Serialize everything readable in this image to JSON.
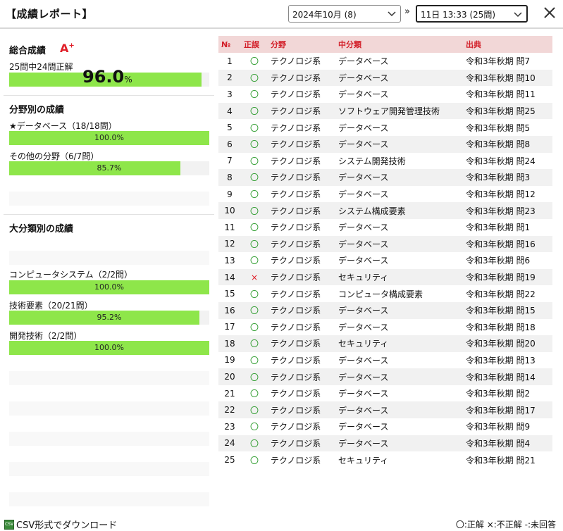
{
  "header": {
    "title": "【成績レポート】",
    "month_select": "2024年10月 (8)",
    "separator": "»",
    "session_select": "11日 13:33 (25問)"
  },
  "overall": {
    "title": "総合成績",
    "grade": "A",
    "grade_sup": "+",
    "summary": "25問中24問正解",
    "percent": "96.0",
    "percent_unit": "%",
    "bar_value": 96.0
  },
  "field": {
    "title": "分野別の成績",
    "items": [
      {
        "label": "★データベース（18/18問）",
        "bar_label": "100.0%",
        "value": 100.0
      },
      {
        "label": "その他の分野（6/7問）",
        "bar_label": "85.7%",
        "value": 85.7
      }
    ]
  },
  "category": {
    "title": "大分類別の成績",
    "items": [
      {
        "label": "コンピュータシステム（2/2問）",
        "bar_label": "100.0%",
        "value": 100.0
      },
      {
        "label": "技術要素（20/21問）",
        "bar_label": "95.2%",
        "value": 95.2
      },
      {
        "label": "開発技術（2/2問）",
        "bar_label": "100.0%",
        "value": 100.0
      }
    ]
  },
  "table": {
    "headers": [
      "№",
      "正誤",
      "分野",
      "中分類",
      "出典"
    ],
    "rows": [
      {
        "no": "1",
        "result": "〇",
        "field": "テクノロジ系",
        "category": "データベース",
        "source": "令和3年秋期 問7"
      },
      {
        "no": "2",
        "result": "〇",
        "field": "テクノロジ系",
        "category": "データベース",
        "source": "令和3年秋期 問10"
      },
      {
        "no": "3",
        "result": "〇",
        "field": "テクノロジ系",
        "category": "データベース",
        "source": "令和3年秋期 問11"
      },
      {
        "no": "4",
        "result": "〇",
        "field": "テクノロジ系",
        "category": "ソフトウェア開発管理技術",
        "source": "令和3年秋期 問25"
      },
      {
        "no": "5",
        "result": "〇",
        "field": "テクノロジ系",
        "category": "データベース",
        "source": "令和3年秋期 問5"
      },
      {
        "no": "6",
        "result": "〇",
        "field": "テクノロジ系",
        "category": "データベース",
        "source": "令和3年秋期 問8"
      },
      {
        "no": "7",
        "result": "〇",
        "field": "テクノロジ系",
        "category": "システム開発技術",
        "source": "令和3年秋期 問24"
      },
      {
        "no": "8",
        "result": "〇",
        "field": "テクノロジ系",
        "category": "データベース",
        "source": "令和3年秋期 問3"
      },
      {
        "no": "9",
        "result": "〇",
        "field": "テクノロジ系",
        "category": "データベース",
        "source": "令和3年秋期 問12"
      },
      {
        "no": "10",
        "result": "〇",
        "field": "テクノロジ系",
        "category": "システム構成要素",
        "source": "令和3年秋期 問23"
      },
      {
        "no": "11",
        "result": "〇",
        "field": "テクノロジ系",
        "category": "データベース",
        "source": "令和3年秋期 問1"
      },
      {
        "no": "12",
        "result": "〇",
        "field": "テクノロジ系",
        "category": "データベース",
        "source": "令和3年秋期 問16"
      },
      {
        "no": "13",
        "result": "〇",
        "field": "テクノロジ系",
        "category": "データベース",
        "source": "令和3年秋期 問6"
      },
      {
        "no": "14",
        "result": "×",
        "field": "テクノロジ系",
        "category": "セキュリティ",
        "source": "令和3年秋期 問19"
      },
      {
        "no": "15",
        "result": "〇",
        "field": "テクノロジ系",
        "category": "コンピュータ構成要素",
        "source": "令和3年秋期 問22"
      },
      {
        "no": "16",
        "result": "〇",
        "field": "テクノロジ系",
        "category": "データベース",
        "source": "令和3年秋期 問15"
      },
      {
        "no": "17",
        "result": "〇",
        "field": "テクノロジ系",
        "category": "データベース",
        "source": "令和3年秋期 問18"
      },
      {
        "no": "18",
        "result": "〇",
        "field": "テクノロジ系",
        "category": "セキュリティ",
        "source": "令和3年秋期 問20"
      },
      {
        "no": "19",
        "result": "〇",
        "field": "テクノロジ系",
        "category": "データベース",
        "source": "令和3年秋期 問13"
      },
      {
        "no": "20",
        "result": "〇",
        "field": "テクノロジ系",
        "category": "データベース",
        "source": "令和3年秋期 問14"
      },
      {
        "no": "21",
        "result": "〇",
        "field": "テクノロジ系",
        "category": "データベース",
        "source": "令和3年秋期 問2"
      },
      {
        "no": "22",
        "result": "〇",
        "field": "テクノロジ系",
        "category": "データベース",
        "source": "令和3年秋期 問17"
      },
      {
        "no": "23",
        "result": "〇",
        "field": "テクノロジ系",
        "category": "データベース",
        "source": "令和3年秋期 問9"
      },
      {
        "no": "24",
        "result": "〇",
        "field": "テクノロジ系",
        "category": "データベース",
        "source": "令和3年秋期 問4"
      },
      {
        "no": "25",
        "result": "〇",
        "field": "テクノロジ系",
        "category": "セキュリティ",
        "source": "令和3年秋期 問21"
      }
    ]
  },
  "footer": {
    "csv_icon": "CSV",
    "csv_label": "CSV形式でダウンロード",
    "legend": "〇:正解 ×:不正解 -:未回答"
  },
  "colors": {
    "bar_fill": "#8ee64a",
    "header_bg": "#f2d7d7",
    "header_text": "#d3202a",
    "correct": "#2a9a2a",
    "wrong": "#e0202a"
  }
}
